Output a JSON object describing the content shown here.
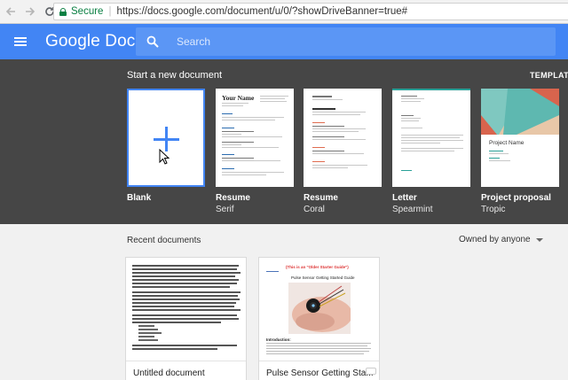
{
  "browser": {
    "secure_label": "Secure",
    "url": "https://docs.google.com/document/u/0/?showDriveBanner=true#",
    "back_icon": "arrow-left-icon",
    "forward_icon": "arrow-right-icon",
    "reload_icon": "reload-icon"
  },
  "header": {
    "app_title": "Google Docs",
    "search_placeholder": "Search",
    "bar_color": "#4285f4"
  },
  "templates": {
    "section_title": "Start a new document",
    "gallery_label": "TEMPLATE",
    "items": [
      {
        "name": "Blank",
        "subtitle": ""
      },
      {
        "name": "Resume",
        "subtitle": "Serif",
        "heading": "Your Name"
      },
      {
        "name": "Resume",
        "subtitle": "Coral"
      },
      {
        "name": "Letter",
        "subtitle": "Spearmint"
      },
      {
        "name": "Project proposal",
        "subtitle": "Tropic",
        "heading": "Project Name"
      }
    ]
  },
  "recent": {
    "section_title": "Recent documents",
    "owner_filter": "Owned by anyone",
    "documents": [
      {
        "title": "Untitled document"
      },
      {
        "title": "Pulse Sensor Getting Sta...",
        "banner": "(This is an \"Older Starter Guide\")",
        "doc_heading": "Pulse Sensor Getting Started Guide",
        "section": "Introduction:"
      }
    ]
  }
}
